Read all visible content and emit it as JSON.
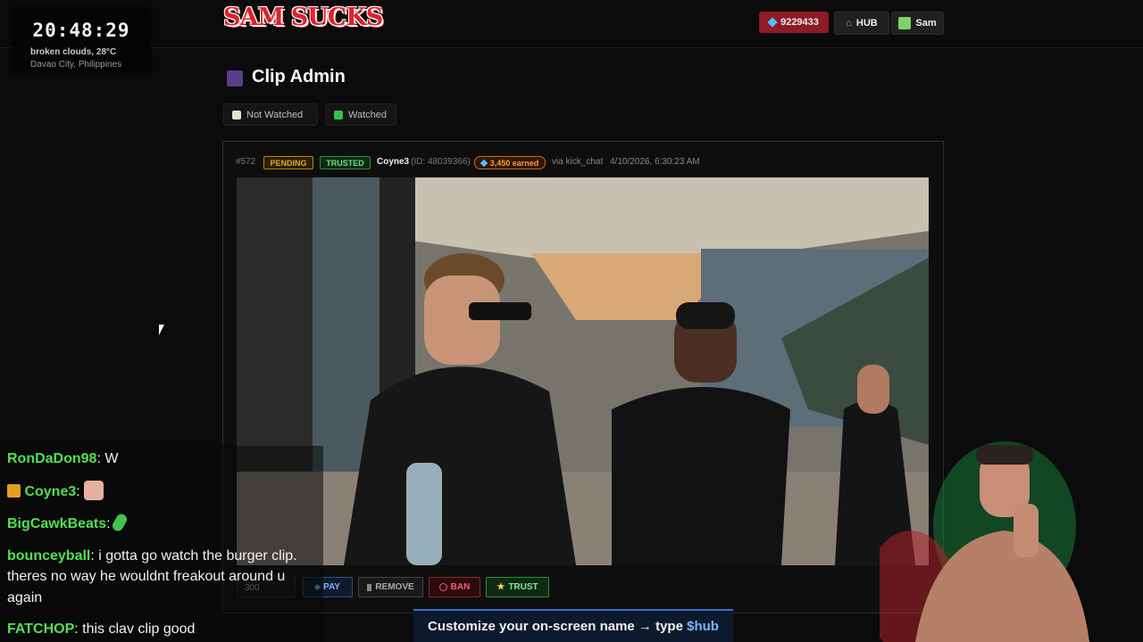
{
  "clock": {
    "time": "20:48:29",
    "weather": "broken clouds, 28°C",
    "location": "Davao City, Philippines"
  },
  "header": {
    "logo": "SAM SUCKS",
    "gems": "9229433",
    "hub_label": "HUB",
    "user_label": "Sam"
  },
  "page": {
    "title": "Clip Admin",
    "filters": [
      {
        "label": "Not Watched"
      },
      {
        "label": "Watched"
      }
    ]
  },
  "clip": {
    "number": "#572",
    "status_badge": "PENDING",
    "trust_badge": "TRUSTED",
    "username": "Coyne3",
    "user_id": "(ID: 48039366)",
    "earned": "3,450 earned",
    "source": "via kick_chat",
    "timestamp": "4/10/2026, 6:30:23 AM",
    "amount_value": "300",
    "actions": {
      "pay": "PAY",
      "remove": "REMOVE",
      "ban": "BAN",
      "trust": "TRUST"
    }
  },
  "chat": {
    "messages": [
      {
        "user": "RonDaDon98",
        "text": "W"
      },
      {
        "user": "Coyne3",
        "text": ""
      },
      {
        "user": "BigCawkBeats",
        "text": ""
      },
      {
        "user": "bounceyball",
        "text": "i gotta go watch the burger clip."
      },
      {
        "user": "",
        "text": "theres no way he wouldnt freakout around u"
      },
      {
        "user": "",
        "text": "again"
      },
      {
        "user": "FATCHOP",
        "text": "this clav clip good"
      }
    ]
  },
  "banner": {
    "prefix": "Customize your on-screen name → type",
    "command": "$hub"
  },
  "colors": {
    "accent_green": "#52e052",
    "brand_red": "#e0212f",
    "gem_blue": "#5ab9ff"
  }
}
